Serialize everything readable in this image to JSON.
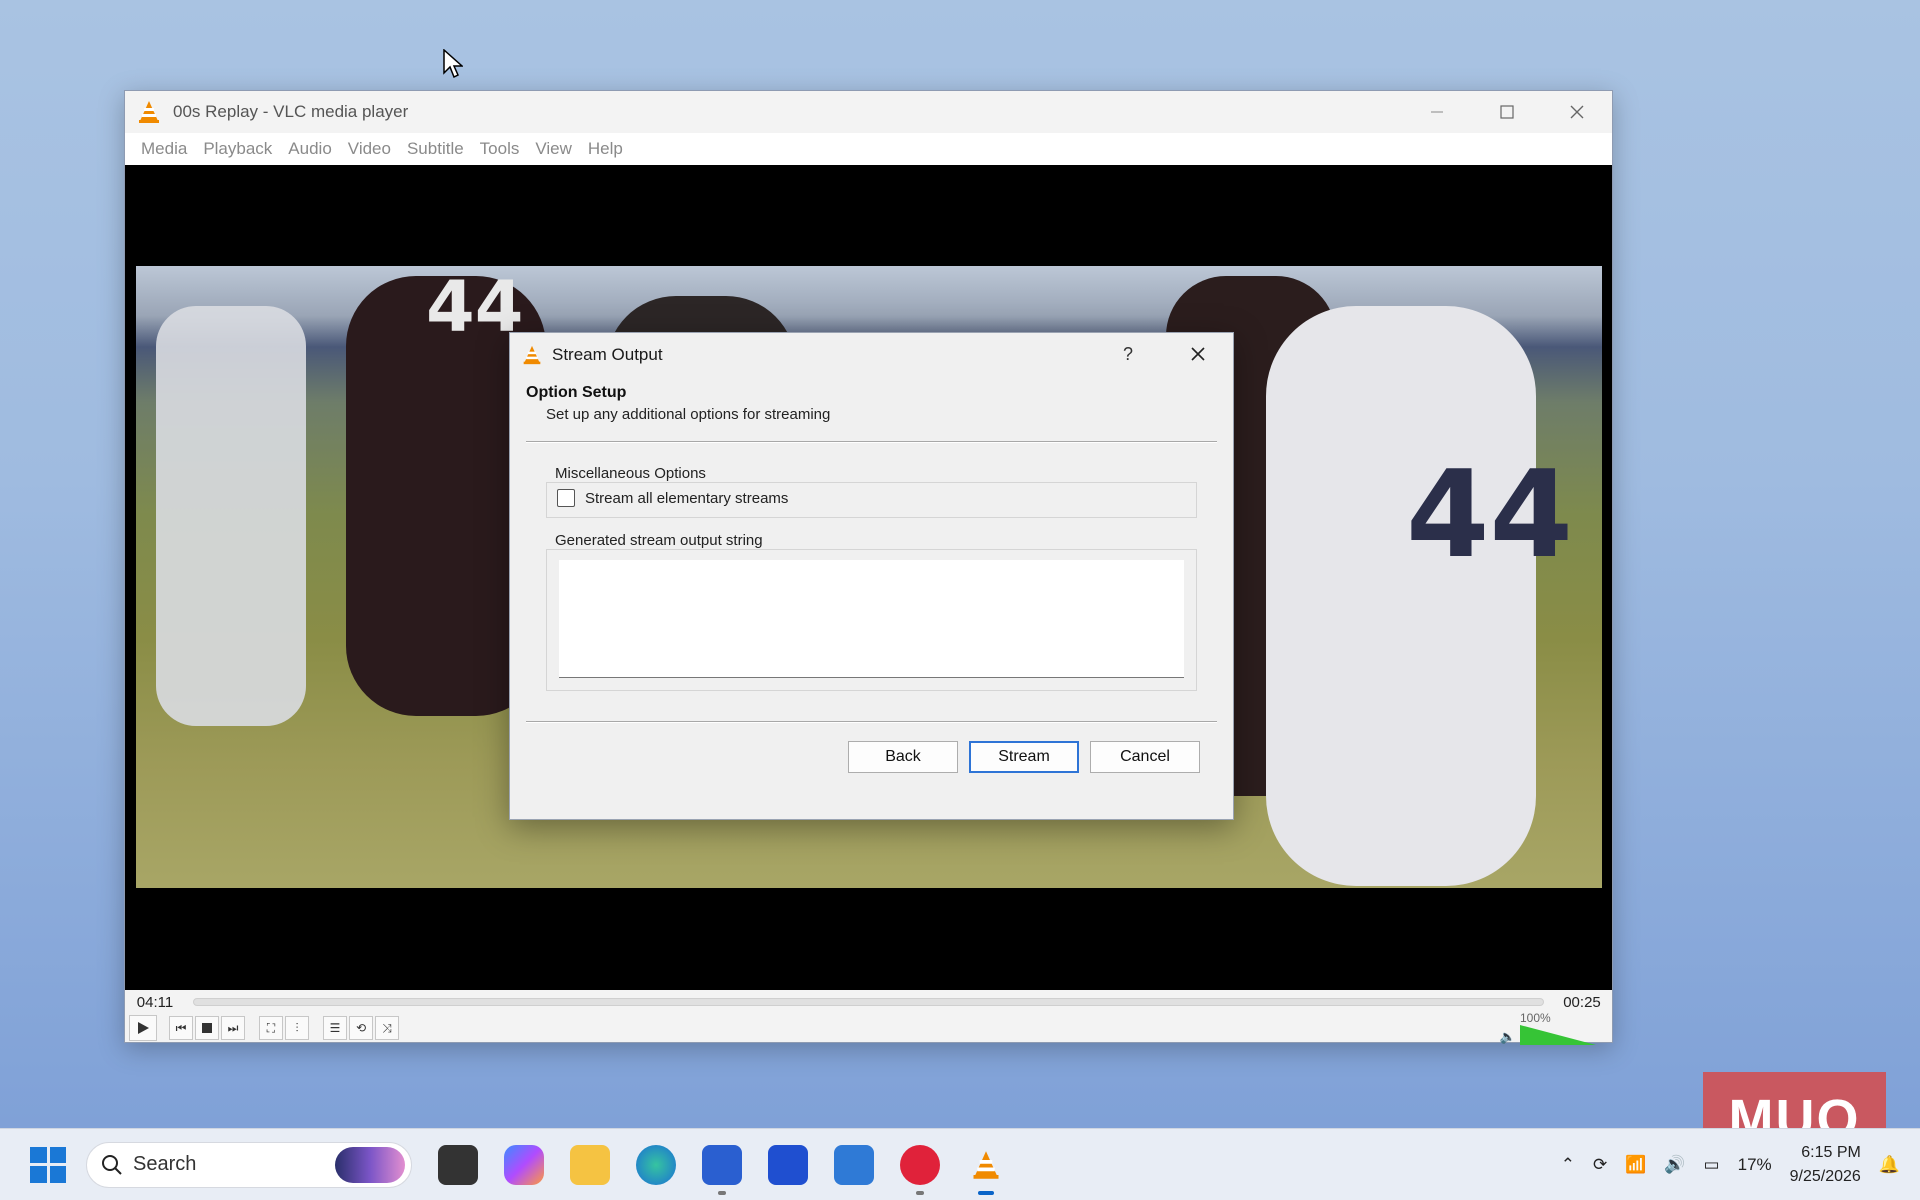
{
  "window": {
    "title": "00s Replay - VLC media player",
    "menu": [
      "Media",
      "Playback",
      "Audio",
      "Video",
      "Subtitle",
      "Tools",
      "View",
      "Help"
    ]
  },
  "player": {
    "elapsed": "04:11",
    "remaining": "00:25",
    "volume_label": "100%",
    "volume_level": 1.0,
    "jersey_front": "44",
    "jersey_back": "44"
  },
  "dialog": {
    "title": "Stream Output",
    "help": "?",
    "heading": "Option Setup",
    "subheading": "Set up any additional options for streaming",
    "misc_group_label": "Miscellaneous Options",
    "stream_all_label": "Stream all elementary streams",
    "stream_all_checked": false,
    "output_group_label": "Generated stream output string",
    "output_value": "",
    "buttons": {
      "back": "Back",
      "stream": "Stream",
      "cancel": "Cancel"
    }
  },
  "taskbar": {
    "search_label": "Search",
    "battery": "17%",
    "time": "6:15 PM",
    "date": "9/25/2026"
  },
  "watermark": "MUO",
  "colors": {
    "accent": "#2e74d6",
    "vlc_orange": "#f08a00",
    "volume_green": "#36c436"
  }
}
